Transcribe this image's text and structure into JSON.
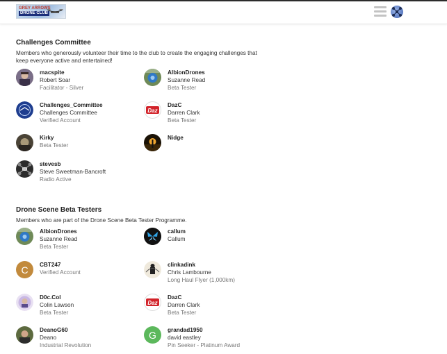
{
  "header": {
    "logo": {
      "line1": "GREY ARROWS",
      "line2": "DRONE CLUB"
    }
  },
  "sections": [
    {
      "title": "Challenges Committee",
      "description_line1": "Members who generously volunteer their time to the club to create the engaging challenges that",
      "description_line2": "keep everyone active and entertained!",
      "members": [
        {
          "username": "macspite",
          "name": "Robert Soar",
          "title": "Facilitator - Silver",
          "avatar": "photo-person"
        },
        {
          "username": "AlbionDrones",
          "name": "Suzanne Read",
          "title": "Beta Tester",
          "avatar": "photo-blue-drone"
        },
        {
          "username": "Challenges_Committee",
          "name": "Challenges Committee",
          "title": "Verified Account",
          "avatar": "committee-badge"
        },
        {
          "username": "DazC",
          "name": "Darren Clark",
          "title": "Beta Tester",
          "avatar": "daz-logo"
        },
        {
          "username": "Kirky",
          "name": "",
          "title": "Beta Tester",
          "avatar": "photo-kirky"
        },
        {
          "username": "Nidge",
          "name": "",
          "title": "",
          "avatar": "photo-sunset"
        },
        {
          "username": "stevesb",
          "name": "Steve Sweetman-Bancroft",
          "title": "Radio Active",
          "avatar": "photo-drone-dark"
        }
      ]
    },
    {
      "title": "Drone Scene Beta Testers",
      "description_line1": "Members who are part of the Drone Scene Beta Tester Programme.",
      "description_line2": "",
      "members": [
        {
          "username": "AlbionDrones",
          "name": "Suzanne Read",
          "title": "Beta Tester",
          "avatar": "photo-blue-drone"
        },
        {
          "username": "callum",
          "name": "Callum",
          "title": "",
          "avatar": "butterfly"
        },
        {
          "username": "CBT247",
          "name": "",
          "title": "Verified Account",
          "avatar": "letter",
          "letter": "C",
          "color": "#c28a3c"
        },
        {
          "username": "clinkadink",
          "name": "Chris Lambourne",
          "title": "Long Haul Flyer (1,000km)",
          "avatar": "photo-silhouette"
        },
        {
          "username": "D0c.Col",
          "name": "Colin Lawson",
          "title": "Beta Tester",
          "avatar": "photo-d0c"
        },
        {
          "username": "DazC",
          "name": "Darren Clark",
          "title": "Beta Tester",
          "avatar": "daz-logo"
        },
        {
          "username": "DeanoG60",
          "name": "Deano",
          "title": "Industrial Revolution",
          "avatar": "photo-deano"
        },
        {
          "username": "grandad1950",
          "name": "david eastley",
          "title": "Pin Seeker - Platinum Award",
          "avatar": "letter",
          "letter": "G",
          "color": "#5cb85c"
        }
      ]
    }
  ],
  "colors": {
    "accent": "#3c5fb0",
    "muted": "#777777"
  }
}
